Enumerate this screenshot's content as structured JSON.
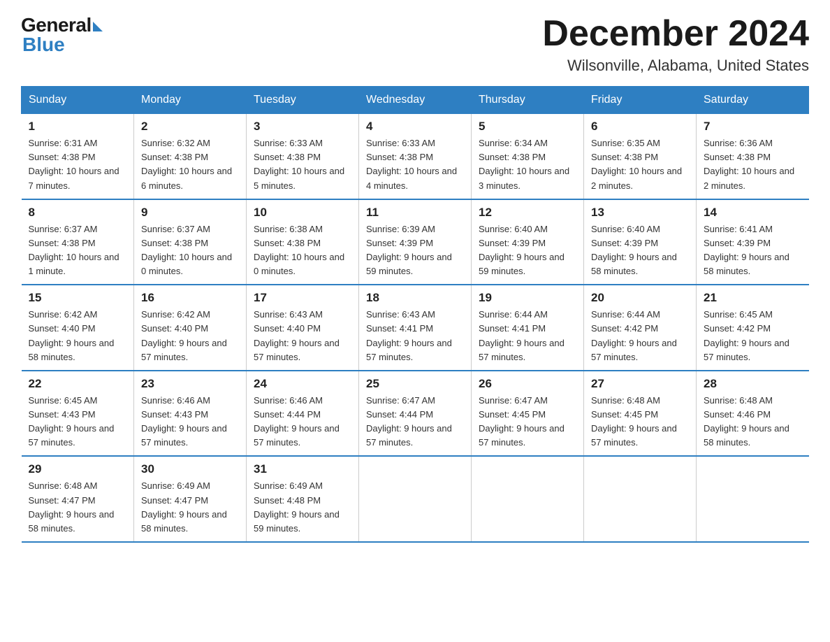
{
  "logo": {
    "general": "General",
    "blue": "Blue"
  },
  "title": "December 2024",
  "location": "Wilsonville, Alabama, United States",
  "days_of_week": [
    "Sunday",
    "Monday",
    "Tuesday",
    "Wednesday",
    "Thursday",
    "Friday",
    "Saturday"
  ],
  "weeks": [
    [
      {
        "day": "1",
        "sunrise": "6:31 AM",
        "sunset": "4:38 PM",
        "daylight": "10 hours and 7 minutes."
      },
      {
        "day": "2",
        "sunrise": "6:32 AM",
        "sunset": "4:38 PM",
        "daylight": "10 hours and 6 minutes."
      },
      {
        "day": "3",
        "sunrise": "6:33 AM",
        "sunset": "4:38 PM",
        "daylight": "10 hours and 5 minutes."
      },
      {
        "day": "4",
        "sunrise": "6:33 AM",
        "sunset": "4:38 PM",
        "daylight": "10 hours and 4 minutes."
      },
      {
        "day": "5",
        "sunrise": "6:34 AM",
        "sunset": "4:38 PM",
        "daylight": "10 hours and 3 minutes."
      },
      {
        "day": "6",
        "sunrise": "6:35 AM",
        "sunset": "4:38 PM",
        "daylight": "10 hours and 2 minutes."
      },
      {
        "day": "7",
        "sunrise": "6:36 AM",
        "sunset": "4:38 PM",
        "daylight": "10 hours and 2 minutes."
      }
    ],
    [
      {
        "day": "8",
        "sunrise": "6:37 AM",
        "sunset": "4:38 PM",
        "daylight": "10 hours and 1 minute."
      },
      {
        "day": "9",
        "sunrise": "6:37 AM",
        "sunset": "4:38 PM",
        "daylight": "10 hours and 0 minutes."
      },
      {
        "day": "10",
        "sunrise": "6:38 AM",
        "sunset": "4:38 PM",
        "daylight": "10 hours and 0 minutes."
      },
      {
        "day": "11",
        "sunrise": "6:39 AM",
        "sunset": "4:39 PM",
        "daylight": "9 hours and 59 minutes."
      },
      {
        "day": "12",
        "sunrise": "6:40 AM",
        "sunset": "4:39 PM",
        "daylight": "9 hours and 59 minutes."
      },
      {
        "day": "13",
        "sunrise": "6:40 AM",
        "sunset": "4:39 PM",
        "daylight": "9 hours and 58 minutes."
      },
      {
        "day": "14",
        "sunrise": "6:41 AM",
        "sunset": "4:39 PM",
        "daylight": "9 hours and 58 minutes."
      }
    ],
    [
      {
        "day": "15",
        "sunrise": "6:42 AM",
        "sunset": "4:40 PM",
        "daylight": "9 hours and 58 minutes."
      },
      {
        "day": "16",
        "sunrise": "6:42 AM",
        "sunset": "4:40 PM",
        "daylight": "9 hours and 57 minutes."
      },
      {
        "day": "17",
        "sunrise": "6:43 AM",
        "sunset": "4:40 PM",
        "daylight": "9 hours and 57 minutes."
      },
      {
        "day": "18",
        "sunrise": "6:43 AM",
        "sunset": "4:41 PM",
        "daylight": "9 hours and 57 minutes."
      },
      {
        "day": "19",
        "sunrise": "6:44 AM",
        "sunset": "4:41 PM",
        "daylight": "9 hours and 57 minutes."
      },
      {
        "day": "20",
        "sunrise": "6:44 AM",
        "sunset": "4:42 PM",
        "daylight": "9 hours and 57 minutes."
      },
      {
        "day": "21",
        "sunrise": "6:45 AM",
        "sunset": "4:42 PM",
        "daylight": "9 hours and 57 minutes."
      }
    ],
    [
      {
        "day": "22",
        "sunrise": "6:45 AM",
        "sunset": "4:43 PM",
        "daylight": "9 hours and 57 minutes."
      },
      {
        "day": "23",
        "sunrise": "6:46 AM",
        "sunset": "4:43 PM",
        "daylight": "9 hours and 57 minutes."
      },
      {
        "day": "24",
        "sunrise": "6:46 AM",
        "sunset": "4:44 PM",
        "daylight": "9 hours and 57 minutes."
      },
      {
        "day": "25",
        "sunrise": "6:47 AM",
        "sunset": "4:44 PM",
        "daylight": "9 hours and 57 minutes."
      },
      {
        "day": "26",
        "sunrise": "6:47 AM",
        "sunset": "4:45 PM",
        "daylight": "9 hours and 57 minutes."
      },
      {
        "day": "27",
        "sunrise": "6:48 AM",
        "sunset": "4:45 PM",
        "daylight": "9 hours and 57 minutes."
      },
      {
        "day": "28",
        "sunrise": "6:48 AM",
        "sunset": "4:46 PM",
        "daylight": "9 hours and 58 minutes."
      }
    ],
    [
      {
        "day": "29",
        "sunrise": "6:48 AM",
        "sunset": "4:47 PM",
        "daylight": "9 hours and 58 minutes."
      },
      {
        "day": "30",
        "sunrise": "6:49 AM",
        "sunset": "4:47 PM",
        "daylight": "9 hours and 58 minutes."
      },
      {
        "day": "31",
        "sunrise": "6:49 AM",
        "sunset": "4:48 PM",
        "daylight": "9 hours and 59 minutes."
      },
      null,
      null,
      null,
      null
    ]
  ]
}
